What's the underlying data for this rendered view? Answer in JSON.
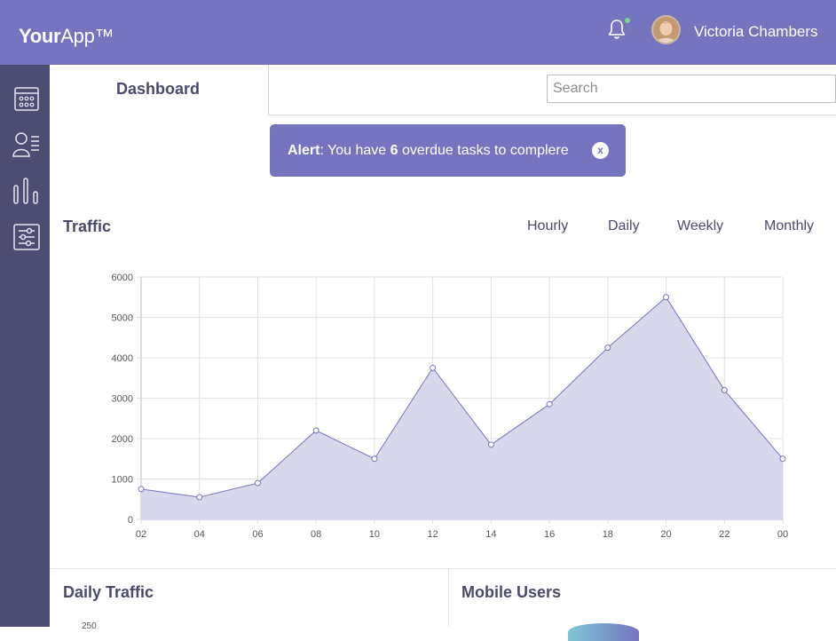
{
  "header": {
    "logo_bold": "Your",
    "logo_rest": "App™",
    "user_name": "Victoria Chambers",
    "notification_status_color": "#7bd68a"
  },
  "sidebar": {
    "items": [
      {
        "icon": "calendar-icon"
      },
      {
        "icon": "users-list-icon"
      },
      {
        "icon": "bar-chart-icon"
      },
      {
        "icon": "settings-sliders-icon"
      }
    ]
  },
  "nav": {
    "active_tab": "Dashboard",
    "search": {
      "placeholder": "Search",
      "value": ""
    }
  },
  "alert": {
    "label": "Alert",
    "text_before": ": You have ",
    "count": "6",
    "text_after": " overdue tasks to complere",
    "close_label": "x"
  },
  "traffic": {
    "title": "Traffic",
    "ranges": [
      "Hourly",
      "Daily",
      "Weekly",
      "Monthly"
    ]
  },
  "chart_data": {
    "type": "area",
    "title": "Traffic",
    "x": [
      "02",
      "04",
      "06",
      "08",
      "10",
      "12",
      "14",
      "16",
      "18",
      "20",
      "22",
      "00"
    ],
    "values": [
      750,
      550,
      900,
      2200,
      1500,
      3750,
      1850,
      2850,
      4250,
      5500,
      3200,
      1500
    ],
    "ylim": [
      0,
      6000
    ],
    "yticks": [
      0,
      1000,
      2000,
      3000,
      4000,
      5000,
      6000
    ],
    "grid": true,
    "line_color": "#7574bf",
    "fill_color": "#d6d5ea"
  },
  "panels": {
    "daily_traffic": {
      "title": "Daily Traffic",
      "first_tick": "250"
    },
    "mobile_users": {
      "title": "Mobile Users"
    }
  },
  "colors": {
    "accent": "#7574bf",
    "sidebar": "#4d4c72"
  }
}
